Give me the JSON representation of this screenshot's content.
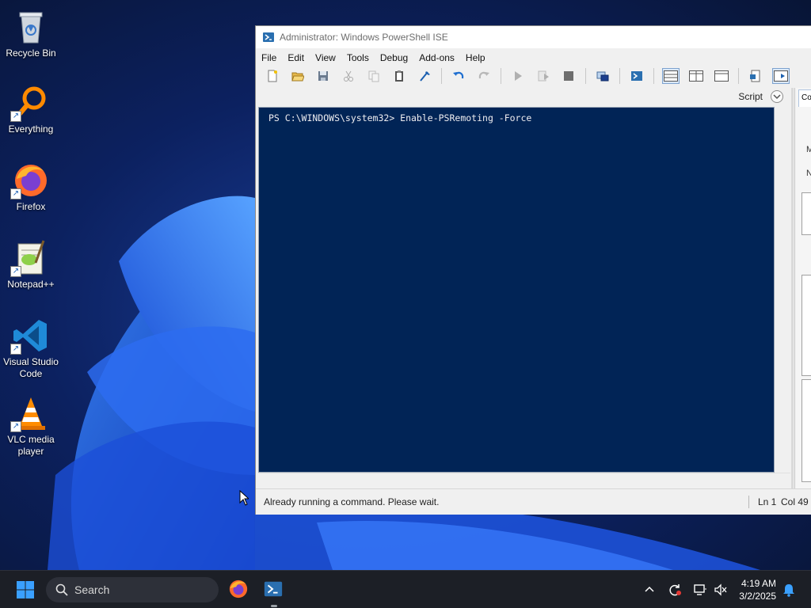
{
  "desktop": {
    "icons": [
      {
        "label": "Recycle Bin"
      },
      {
        "label": "Everything"
      },
      {
        "label": "Firefox"
      },
      {
        "label": "Notepad++"
      },
      {
        "label": "Visual Studio Code"
      },
      {
        "label": "VLC media player"
      }
    ]
  },
  "ise": {
    "title": "Administrator: Windows PowerShell ISE",
    "menu": [
      "File",
      "Edit",
      "View",
      "Tools",
      "Debug",
      "Add-ons",
      "Help"
    ],
    "toolbar_icons": [
      "new-icon",
      "open-icon",
      "save-icon",
      "cut-icon",
      "copy-icon",
      "paste-icon",
      "clear-icon",
      "undo-icon",
      "redo-icon",
      "run-icon",
      "run-selection-icon",
      "stop-icon",
      "remote-icon",
      "powershell-icon",
      "layout-top-icon",
      "layout-right-icon",
      "layout-max-icon",
      "addon-icon",
      "show-commands-icon"
    ],
    "script_label": "Script",
    "console_command": "PS C:\\WINDOWS\\system32> Enable-PSRemoting -Force",
    "right_pane": {
      "tab": "Co",
      "label1": "M",
      "label2": "N"
    },
    "status_message": "Already running a command. Please wait.",
    "ln": "Ln 1",
    "col": "Col 49"
  },
  "taskbar": {
    "search_placeholder": "Search",
    "time": "4:19 AM",
    "date": "3/2/2025"
  },
  "colors": {
    "console_bg": "#012456",
    "taskbar_bg": "#1c1f26",
    "accent": "#0078d4"
  }
}
